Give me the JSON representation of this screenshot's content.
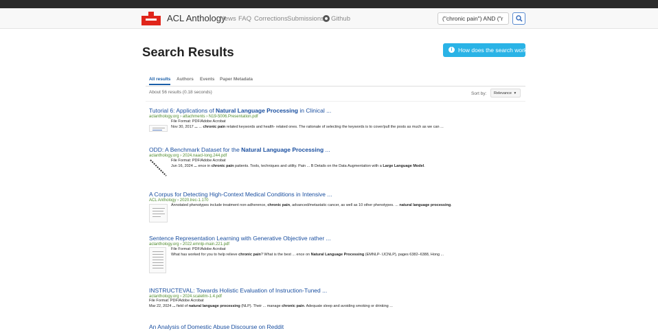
{
  "navbar": {
    "brand": "ACL Anthology",
    "links": [
      "News",
      "FAQ",
      "Corrections",
      "Submissions",
      "Github"
    ],
    "search_value": "(\"chronic pain\") AND (\"r",
    "brand_color": "#e0251b"
  },
  "header": {
    "title": "Search Results",
    "help_button": "How does the search work?"
  },
  "tabs": [
    "All results",
    "Authors",
    "Events",
    "Paper Metadata"
  ],
  "summary": {
    "count": "About 56 results (0.18 seconds)",
    "sort_label": "Sort by:",
    "sort_value": "Relevance"
  },
  "results": [
    {
      "title_pre": "Tutorial 6: Applications of ",
      "title_bold": "Natural Language Processing",
      "title_post": " in Clinical ...",
      "url": "aclanthology.org › attachments › N19-5006.Presentation.pdf",
      "file_format": "File Format: PDF/Adobe Acrobat",
      "snippet_parts": [
        "Nov 30, 2017 ",
        "...",
        " ... ",
        "chronic pain",
        " related keywords and health- related ones. The rationale of selecting the keywords is to cover/pull the posts as much as we can ..."
      ]
    },
    {
      "title_pre": "ODD: A Benchmark Dataset for the ",
      "title_bold": "Natural Language Processing",
      "title_post": " ...",
      "url": "aclanthology.org › 2024.naacl-long.244.pdf",
      "file_format": "File Format: PDF/Adobe Acrobat",
      "snippet_parts": [
        "Jun 16, 2024 ",
        "...",
        " ence in ",
        "chronic pain",
        " patients. Tools, techniques and utility. Pain ... B Details on the Data Augmentation with a ",
        "Large Language Model",
        "."
      ]
    },
    {
      "title_pre": "A Corpus for Detecting High-Context Medical Conditions in Intensive ...",
      "url": "ACL Anthology › 2020.lrec-1.170",
      "snippet_parts": [
        "Annotated phenotypes include treatment non-adherence, ",
        "chronic pain",
        ", advanced/metastatic cancer, as well as 10 other phenotypes. ... ",
        "natural language processing",
        "."
      ]
    },
    {
      "title_pre": "Sentence Representation Learning with Generative Objective rather ...",
      "url": "aclanthology.org › 2022.emnlp-main.221.pdf",
      "file_format": "File Format: PDF/Adobe Acrobat",
      "snippet_parts": [
        "What has worked for you to help relieve ",
        "chronic pain",
        "? What is the best ... ence on ",
        "Natural Language Processing",
        " (EMNLP-  IJCNLP), pages 6382–6388, Hong ..."
      ]
    },
    {
      "title_pre": "INSTRUCTEVAL: Towards Holistic Evaluation of Instruction-Tuned ...",
      "url": "aclanthology.org › 2024.scalellm-1.4.pdf",
      "file_format": "File Format: PDF/Adobe Acrobat",
      "snippet_parts": [
        "Mar 22, 2024 ",
        "...",
        " field of ",
        "natural language processing",
        " (NLP). Their ... manage ",
        "chronic pain",
        ". Adequate sleep and avoiding smoking or drinking ..."
      ]
    },
    {
      "title_pre": "An Analysis of Domestic Abuse Discourse on Reddit"
    }
  ]
}
